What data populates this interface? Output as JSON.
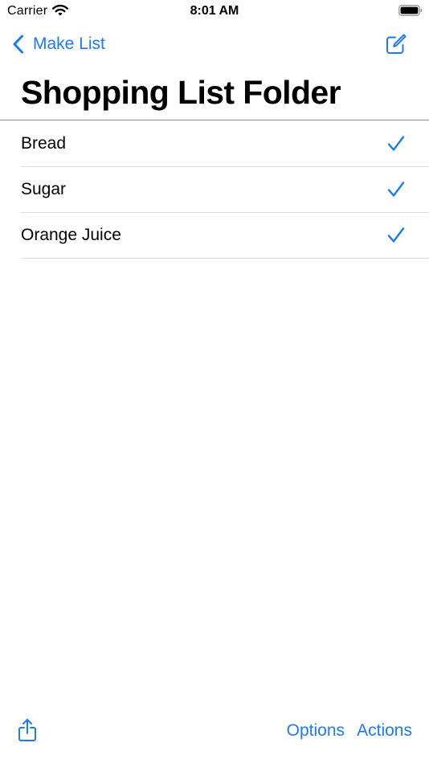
{
  "status_bar": {
    "carrier": "Carrier",
    "time": "8:01 AM",
    "icons": [
      "wifi-icon",
      "battery-icon"
    ]
  },
  "nav": {
    "back_label": "Make List",
    "back_icon": "chevron-left-icon",
    "compose_icon": "compose-icon"
  },
  "page": {
    "title": "Shopping List Folder"
  },
  "items": [
    {
      "label": "Bread",
      "checked": true
    },
    {
      "label": "Sugar",
      "checked": true
    },
    {
      "label": "Orange Juice",
      "checked": true
    }
  ],
  "toolbar": {
    "share_icon": "share-icon",
    "options_label": "Options",
    "actions_label": "Actions"
  },
  "colors": {
    "accent": "#1a7bf2",
    "title_divider": "#34c759",
    "row_separator": "#dcdcde"
  }
}
